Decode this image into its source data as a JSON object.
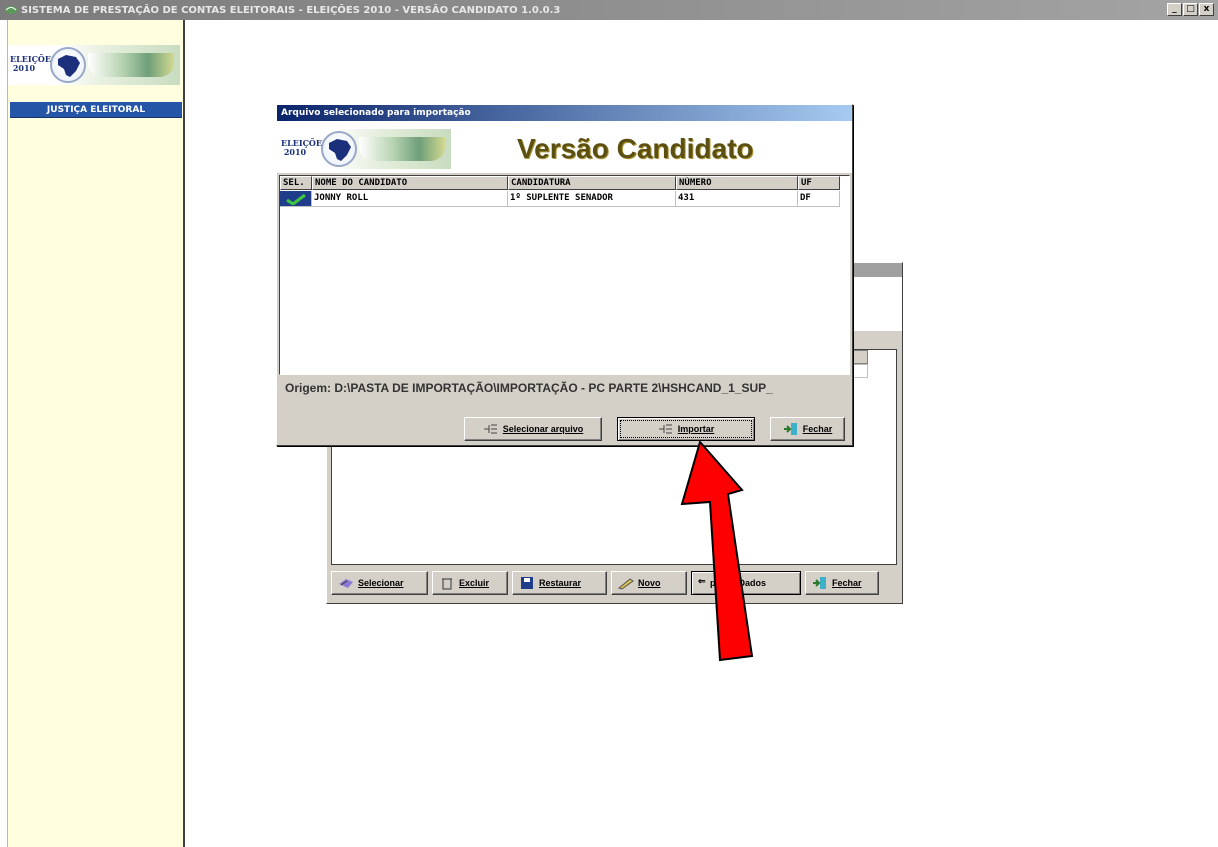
{
  "app": {
    "title": "SISTEMA DE PRESTAÇÃO DE CONTAS ELEITORAIS - ELEIÇÕES 2010 - VERSÃO CANDIDATO 1.0.0.3",
    "controls": [
      "_",
      "□",
      "x"
    ]
  },
  "sidebar": {
    "logo_line1": "ELEIÇÕES",
    "logo_line2": "2010",
    "justica": "JUSTIÇA ELEITORAL"
  },
  "background_window": {
    "buttons": {
      "selecionar": "Selecionar",
      "excluir": "Excluir",
      "restaurar": "Restaurar",
      "novo": "Novo",
      "importar_dados": "portar Dados",
      "fechar": "Fechar"
    }
  },
  "dialog": {
    "title": "Arquivo selecionado para importação",
    "logo_line1": "ELEIÇÕES",
    "logo_line2": "2010",
    "heading": "Versão Candidato",
    "columns": [
      "SEL.",
      "NOME DO CANDIDATO",
      "CANDIDATURA",
      "NÚMERO",
      "UF"
    ],
    "rows": [
      {
        "nome": "JONNY ROLL",
        "candidatura": "1º SUPLENTE SENADOR",
        "numero": "431",
        "uf": "DF"
      }
    ],
    "origem": "Origem: D:\\PASTA DE IMPORTAÇÃO\\IMPORTAÇÃO - PC PARTE 2\\HSHCAND_1_SUP_",
    "buttons": {
      "selecionar_arquivo": "Selecionar arquivo",
      "importar": "Importar",
      "fechar": "Fechar"
    }
  },
  "colors": {
    "sidebar_bg": "#ffffe0",
    "justica_bar": "#2455a6",
    "heading": "#5b4f12",
    "arrow": "#ff0000"
  }
}
